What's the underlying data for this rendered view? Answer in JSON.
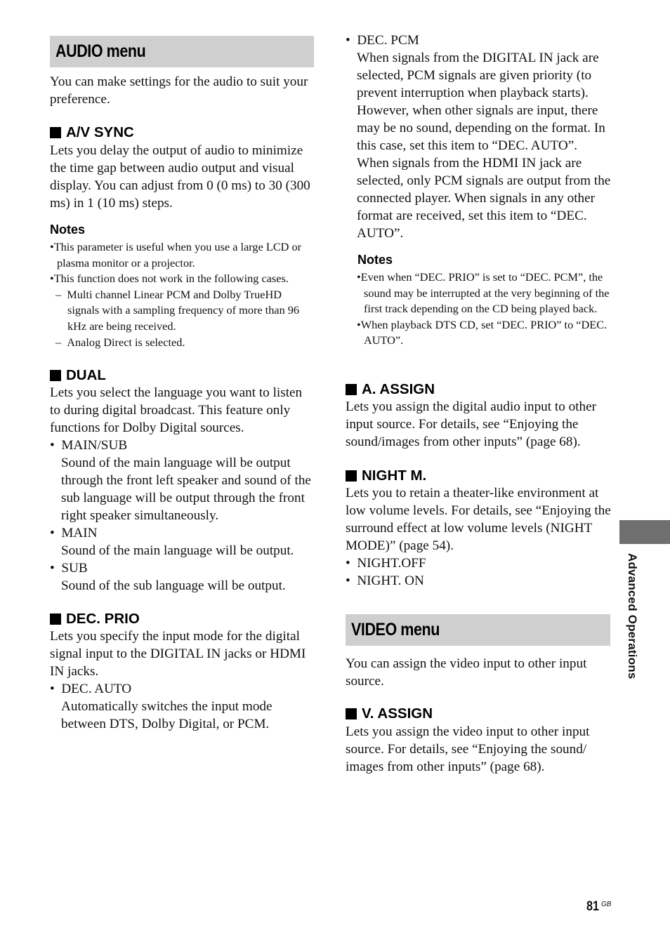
{
  "audio_menu": {
    "title": "AUDIO menu",
    "intro": "You can make settings for the audio to suit your preference.",
    "av_sync": {
      "heading": "A/V SYNC",
      "body": "Lets you delay the output of audio to minimize the time gap between audio output and visual display. You can adjust from 0 (0 ms) to 30 (300 ms) in 1 (10 ms) steps.",
      "notes_heading": "Notes",
      "notes": [
        "This parameter is useful when you use a large LCD or plasma monitor or a projector.",
        "This function does not work in the following cases."
      ],
      "sub_notes": [
        "Multi channel Linear PCM and Dolby TrueHD signals with a sampling frequency of more than 96 kHz are being received.",
        "Analog Direct is selected."
      ]
    },
    "dual": {
      "heading": "DUAL",
      "body": "Lets you select the language you want to listen to during digital broadcast. This feature only functions for Dolby Digital sources.",
      "options": [
        {
          "label": "MAIN/SUB",
          "desc": "Sound of the main language will be output through the front left speaker and sound of the sub language will be output through the front right speaker simultaneously."
        },
        {
          "label": "MAIN",
          "desc": "Sound of the main language will be output."
        },
        {
          "label": "SUB",
          "desc": "Sound of the sub language will be output."
        }
      ]
    },
    "dec_prio": {
      "heading": "DEC. PRIO",
      "body": "Lets you specify the input mode for the digital signal input to the DIGITAL IN jacks or HDMI IN jacks.",
      "options": [
        {
          "label": "DEC. AUTO",
          "desc": "Automatically switches the input mode between DTS, Dolby Digital, or PCM."
        },
        {
          "label": "DEC. PCM",
          "desc": "When signals from the DIGITAL IN jack are selected, PCM signals are given priority (to prevent interruption when playback starts). However, when other signals are input, there may be no sound, depending on the format. In this case, set this item to “DEC. AUTO”. When signals from the HDMI IN jack are selected, only PCM signals are output from the connected player. When signals in any other format are received, set this item to “DEC. AUTO”."
        }
      ],
      "notes_heading": "Notes",
      "notes": [
        "Even when “DEC. PRIO” is set to “DEC. PCM”, the sound may be interrupted at the very beginning of the first track depending on the CD being played back.",
        "When playback DTS CD, set “DEC. PRIO” to “DEC. AUTO”."
      ]
    },
    "a_assign": {
      "heading": "A. ASSIGN",
      "body": "Lets you assign the digital audio input to other input source. For details, see “Enjoying the sound/images from other inputs” (page 68)."
    },
    "night_m": {
      "heading": "NIGHT M.",
      "body": "Lets you to retain a theater-like environment at low volume levels. For details, see “Enjoying the surround effect at low volume levels (NIGHT MODE)” (page 54).",
      "options": [
        "NIGHT.OFF",
        "NIGHT. ON"
      ]
    }
  },
  "video_menu": {
    "title": "VIDEO menu",
    "intro": "You can assign the video input to other input source.",
    "v_assign": {
      "heading": "V. ASSIGN",
      "body": "Lets you assign the video input to other input source. For details, see “Enjoying the sound/ images from other inputs” (page 68)."
    }
  },
  "side_tab": {
    "label": "Advanced Operations"
  },
  "footer": {
    "page_number": "81",
    "page_suffix": "GB"
  }
}
